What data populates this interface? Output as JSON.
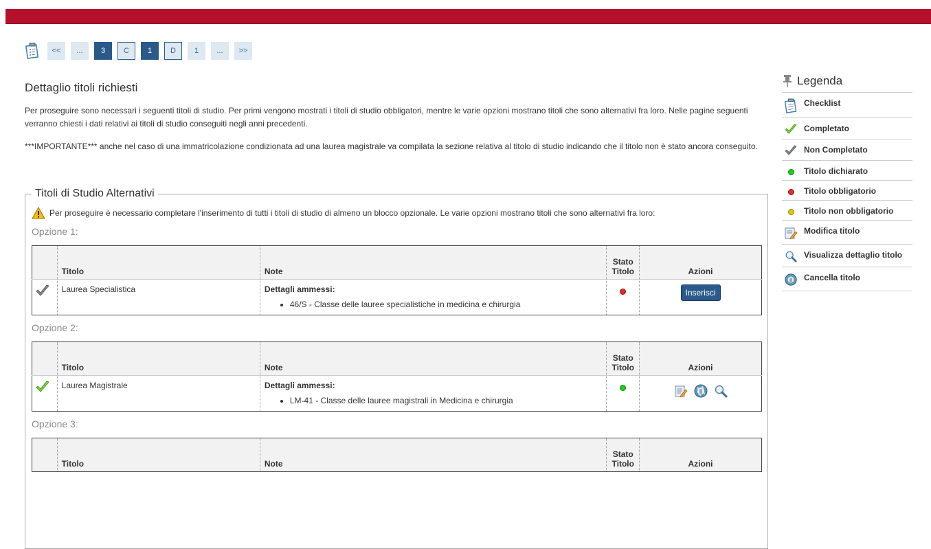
{
  "pager": {
    "items": [
      {
        "label": "<<",
        "style": "plain"
      },
      {
        "label": "...",
        "style": "plain"
      },
      {
        "label": "3",
        "style": "dark"
      },
      {
        "label": "C",
        "style": "outline"
      },
      {
        "label": "1",
        "style": "dark"
      },
      {
        "label": "D",
        "style": "outline"
      },
      {
        "label": "1",
        "style": "plain"
      },
      {
        "label": "...",
        "style": "plain"
      },
      {
        "label": ">>",
        "style": "plain"
      }
    ]
  },
  "main": {
    "title": "Dettaglio titoli richiesti",
    "intro": "Per proseguire sono necessari i seguenti titoli di studio. Per primi vengono mostrati i titoli di studio obbligatori, mentre le varie opzioni mostrano titoli che sono alternativi fra loro. Nelle pagine seguenti verranno chiesti i dati relativi ai titoli di studio conseguiti negli anni precedenti.",
    "important": "***IMPORTANTE*** anche nel caso di una immatricolazione condizionata ad una laurea magistrale va compilata la sezione relativa al titolo di studio indicando che il titolo non è stato ancora conseguito.",
    "fieldset_title": "Titoli di Studio Alternativi",
    "warning": "Per proseguire è necessario completare l'inserimento di tutti i titoli di studio di almeno un blocco opzionale. Le varie opzioni mostrano titoli che sono alternativi fra loro:"
  },
  "table_headers": {
    "titolo": "Titolo",
    "note": "Note",
    "stato": "Stato Titolo",
    "azioni": "Azioni"
  },
  "options": [
    {
      "label": "Opzione 1:",
      "titolo": "Laurea Specialistica",
      "note_title": "Dettagli ammessi:",
      "note_item": "46/S - Classe delle lauree specialistiche in medicina e chirurgia",
      "status": "red",
      "check": "grey",
      "action": "Inserisci"
    },
    {
      "label": "Opzione 2:",
      "titolo": "Laurea Magistrale",
      "note_title": "Dettagli ammessi:",
      "note_item": "LM-41 - Classe delle lauree magistrali in Medicina e chirurgia",
      "status": "green",
      "check": "green",
      "action": "icons"
    },
    {
      "label": "Opzione 3:"
    }
  ],
  "legend": {
    "title": "Legenda",
    "items": [
      {
        "icon": "checklist-icon",
        "label": "Checklist"
      },
      {
        "icon": "check-green-icon",
        "label": "Completato"
      },
      {
        "icon": "check-grey-icon",
        "label": "Non Completato"
      },
      {
        "icon": "dot-green-icon",
        "label": "Titolo dichiarato"
      },
      {
        "icon": "dot-red-icon",
        "label": "Titolo obbligatorio"
      },
      {
        "icon": "dot-yellow-icon",
        "label": "Titolo non obbligatorio"
      },
      {
        "icon": "edit-icon",
        "label": "Modifica titolo"
      },
      {
        "icon": "magnifier-icon",
        "label": "Visualizza dettaglio titolo"
      },
      {
        "icon": "delete-globe-icon",
        "label": "Cancella titolo"
      }
    ]
  },
  "colors": {
    "brand": "#b5102c",
    "button": "#2a5a8a"
  }
}
